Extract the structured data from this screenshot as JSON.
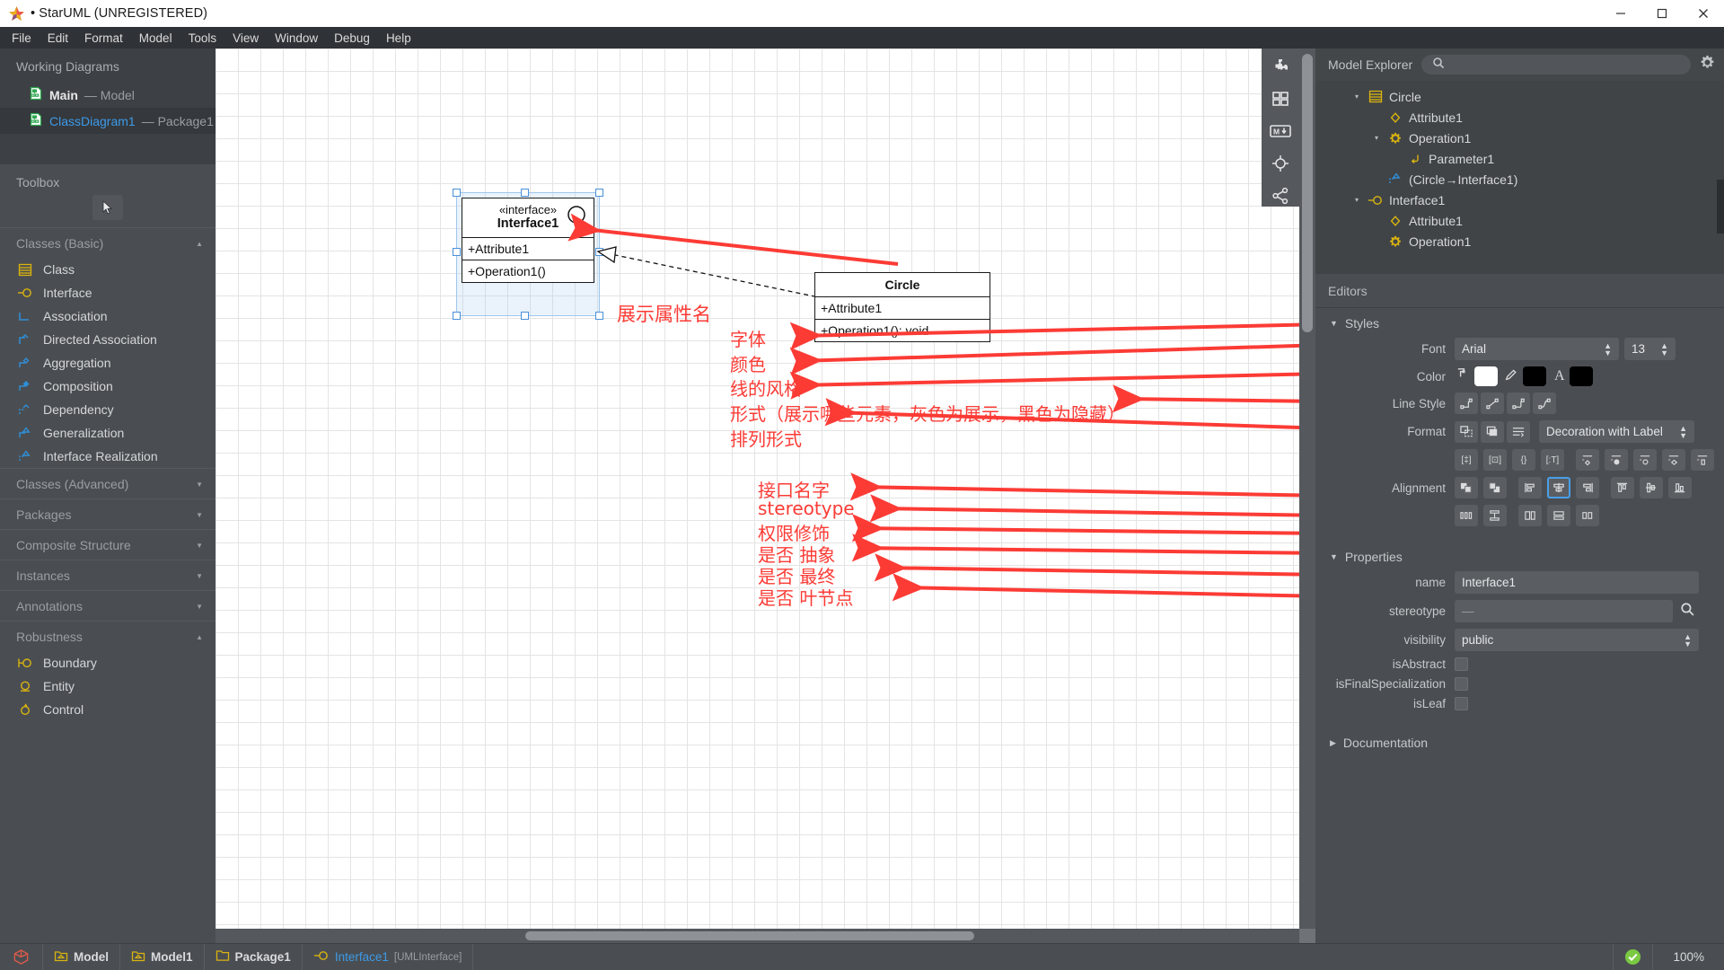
{
  "titlebar": {
    "title": "• StarUML (UNREGISTERED)",
    "star_icon": "star-icon",
    "minimize": "minimize-icon",
    "maximize": "maximize-icon",
    "close": "close-icon"
  },
  "menubar": {
    "items": [
      "File",
      "Edit",
      "Format",
      "Model",
      "Tools",
      "View",
      "Window",
      "Debug",
      "Help"
    ]
  },
  "sidebar": {
    "working_diagrams_header": "Working Diagrams",
    "diagrams": [
      {
        "name": "Main",
        "sub": "— Model",
        "selected": false
      },
      {
        "name": "ClassDiagram1",
        "sub": "— Package1",
        "selected": true
      }
    ],
    "toolbox_header": "Toolbox",
    "cursor_icon": "pointer-cursor-icon",
    "groups": [
      {
        "label": "Classes (Basic)",
        "caret": "▲",
        "items": [
          {
            "label": "Class",
            "icon": "class-icon"
          },
          {
            "label": "Interface",
            "icon": "interface-icon"
          },
          {
            "label": "Association",
            "icon": "association-icon"
          },
          {
            "label": "Directed Association",
            "icon": "directed-association-icon"
          },
          {
            "label": "Aggregation",
            "icon": "aggregation-icon"
          },
          {
            "label": "Composition",
            "icon": "composition-icon"
          },
          {
            "label": "Dependency",
            "icon": "dependency-icon"
          },
          {
            "label": "Generalization",
            "icon": "generalization-icon"
          },
          {
            "label": "Interface Realization",
            "icon": "interface-realization-icon"
          }
        ]
      },
      {
        "label": "Classes (Advanced)",
        "caret": "▼",
        "items": []
      },
      {
        "label": "Packages",
        "caret": "▼",
        "items": []
      },
      {
        "label": "Composite Structure",
        "caret": "▼",
        "items": []
      },
      {
        "label": "Instances",
        "caret": "▼",
        "items": []
      },
      {
        "label": "Annotations",
        "caret": "▼",
        "items": []
      },
      {
        "label": "Robustness",
        "caret": "▲",
        "items": [
          {
            "label": "Boundary",
            "icon": "boundary-icon"
          },
          {
            "label": "Entity",
            "icon": "entity-icon"
          },
          {
            "label": "Control",
            "icon": "control-icon"
          }
        ]
      }
    ]
  },
  "canvas": {
    "vertical_toolbar": [
      "puzzle-icon",
      "grid-icon",
      "markdown-icon",
      "target-icon",
      "share-icon"
    ],
    "interface_shape": {
      "stereotype": "«interface»",
      "name": "Interface1",
      "attribute": "+Attribute1",
      "operation": "+Operation1()"
    },
    "circle_shape": {
      "name": "Circle",
      "attribute": "+Attribute1",
      "operation": "+Operation1(): void"
    },
    "annotations": [
      {
        "text": "展示属性名",
        "key": "show_attribute_name"
      },
      {
        "text": "字体",
        "key": "font"
      },
      {
        "text": "颜色",
        "key": "color"
      },
      {
        "text": "线的风格",
        "key": "line_style"
      },
      {
        "text": "形式（展示哪些元素，灰色为展示，黑色为隐藏）",
        "key": "format"
      },
      {
        "text": "排列形式",
        "key": "alignment"
      },
      {
        "text": "接口名字",
        "key": "interface_name"
      },
      {
        "text": "stereotype",
        "key": "stereotype"
      },
      {
        "text": "权限修饰",
        "key": "visibility"
      },
      {
        "text": "是否 抽象",
        "key": "is_abstract"
      },
      {
        "text": "是否 最终",
        "key": "is_final"
      },
      {
        "text": "是否 叶节点",
        "key": "is_leaf"
      }
    ]
  },
  "model_explorer": {
    "title": "Model Explorer",
    "search_icon": "search-icon",
    "search_placeholder": "",
    "gear_icon": "gear-icon",
    "tree": [
      {
        "label": "Circle",
        "icon": "class-icon",
        "indent": 0,
        "twisty": "▾"
      },
      {
        "label": "Attribute1",
        "icon": "attribute-icon",
        "indent": 1,
        "twisty": ""
      },
      {
        "label": "Operation1",
        "icon": "operation-icon",
        "indent": 1,
        "twisty": "▾"
      },
      {
        "label": "Parameter1",
        "icon": "parameter-icon",
        "indent": 2,
        "twisty": ""
      },
      {
        "label": "(Circle→Interface1)",
        "icon": "interface-realization-icon",
        "indent": 1,
        "twisty": ""
      },
      {
        "label": "Interface1",
        "icon": "interface-icon",
        "indent": 0,
        "twisty": "▾"
      },
      {
        "label": "Attribute1",
        "icon": "attribute-icon",
        "indent": 1,
        "twisty": ""
      },
      {
        "label": "Operation1",
        "icon": "operation-icon",
        "indent": 1,
        "twisty": ""
      }
    ]
  },
  "editors": {
    "header": "Editors",
    "styles": {
      "title": "Styles",
      "triangle": "▼",
      "font_label": "Font",
      "font_value": "Arial",
      "font_size": "13",
      "color_label": "Color",
      "fill_color": "#ffffff",
      "line_color": "#000000",
      "text_color": "#000000",
      "fill_icon": "paint-bucket-icon",
      "pencil_icon": "pencil-icon",
      "font_color_icon": "font-color-icon",
      "line_style_label": "Line Style",
      "line_styles": [
        "rectilinear-icon",
        "oblique-icon",
        "rounded-rectilinear-icon",
        "curve-icon"
      ],
      "format_label": "Format",
      "format_buttons": [
        "auto-resize-icon",
        "show-shadow-icon",
        "word-wrap-icon"
      ],
      "format_select": "Decoration with Label",
      "show_buttons": [
        "show-property-icon",
        "show-compartment-icon",
        "show-namespace-icon",
        "show-type-icon",
        "hide-attribute-icon",
        "hide-operation-icon",
        "hide-receptions-icon",
        "hide-template-icon",
        "hide-port-icon"
      ],
      "alignment_label": "Alignment",
      "alignment_row1": [
        "bring-to-front-icon",
        "send-to-back-icon",
        "align-left-icon",
        "align-center-icon",
        "align-right-icon",
        "align-top-icon",
        "align-middle-icon",
        "align-bottom-icon"
      ],
      "alignment_row2": [
        "distribute-horizontal-icon",
        "distribute-vertical-icon",
        "same-height-icon",
        "same-width-icon",
        "same-size-icon"
      ],
      "active_alignment": "align-center-icon"
    },
    "properties": {
      "title": "Properties",
      "triangle": "▼",
      "name_label": "name",
      "name_value": "Interface1",
      "stereotype_label": "stereotype",
      "stereotype_value": "—",
      "stereotype_search_icon": "search-icon",
      "visibility_label": "visibility",
      "visibility_value": "public",
      "isabstract_label": "isAbstract",
      "isabstract_checked": false,
      "isfinal_label": "isFinalSpecialization",
      "isfinal_checked": false,
      "isleaf_label": "isLeaf",
      "isleaf_checked": false
    },
    "documentation": {
      "title": "Documentation",
      "triangle": "▶"
    }
  },
  "statusbar": {
    "project_icon": "project-icon",
    "items": [
      {
        "label": "Model",
        "icon": "model-icon",
        "suffix": ""
      },
      {
        "label": "Model1",
        "icon": "model-icon",
        "suffix": ""
      },
      {
        "label": "Package1",
        "icon": "package-icon",
        "suffix": ""
      },
      {
        "label": "Interface1",
        "icon": "interface-icon",
        "suffix": "[UMLInterface]",
        "highlight": true
      }
    ],
    "status_icon": "check-ok-icon",
    "zoom": "100%"
  },
  "colors": {
    "accent_blue": "#3d9ae8",
    "annotation_red": "#fc3b35",
    "yellow_icon": "#d9b310",
    "blue_icon": "#2f8fd8"
  }
}
